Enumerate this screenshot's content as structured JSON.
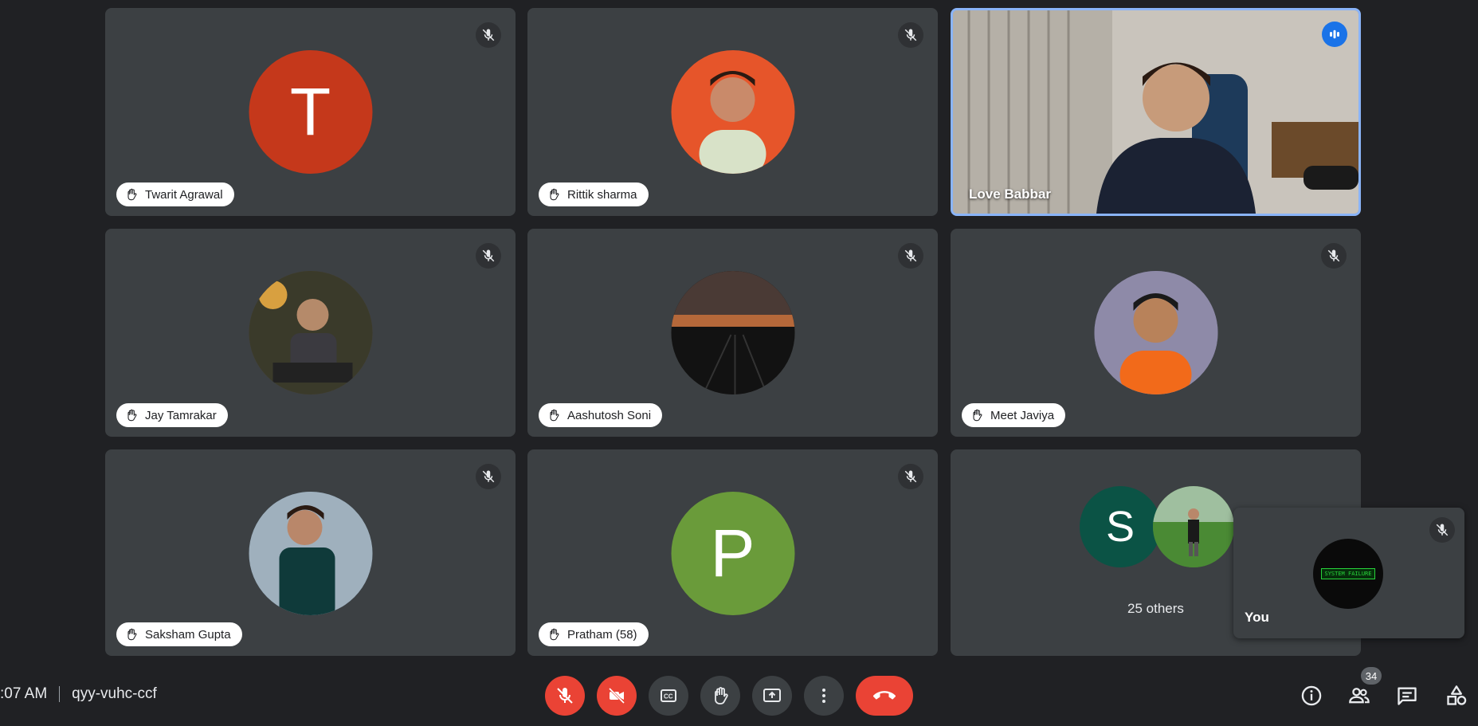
{
  "participants": [
    {
      "name": "Twarit Agrawal",
      "initial": "T",
      "avatar_color": "#c5381b"
    },
    {
      "name": "Rittik sharma",
      "avatar_color": "#e6552a"
    },
    {
      "name": "Jay Tamrakar",
      "avatar_color": "#5a4a36"
    },
    {
      "name": "Aashutosh Soni",
      "avatar_color": "#2b2622"
    },
    {
      "name": "Meet Javiya",
      "avatar_color": "#7d7aa0"
    },
    {
      "name": "Saksham Gupta",
      "avatar_color": "#4d6a7e"
    },
    {
      "name": "Pratham (58)",
      "initial": "P",
      "avatar_color": "#6a9b3a"
    }
  ],
  "active_speaker": {
    "name": "Love Babbar",
    "highlight_color": "#8ab4f8"
  },
  "others": {
    "label": "25 others",
    "initial": "S",
    "initial_color": "#0b5345"
  },
  "self": {
    "label": "You",
    "avatar_text": "SYSTEM FAILURE"
  },
  "meeting": {
    "time": ":07 AM",
    "code": "qyy-vuhc-ccf"
  },
  "people_count": "34",
  "colors": {
    "danger": "#ea4335",
    "tile": "#3c4043",
    "background": "#202124"
  }
}
